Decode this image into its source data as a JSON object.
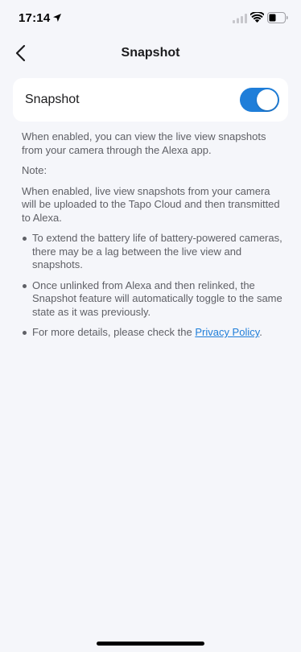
{
  "status_bar": {
    "time": "17:14",
    "location_icon": "location-arrow-icon",
    "signal_icon": "cellular-signal-icon",
    "wifi_icon": "wifi-icon",
    "battery_icon": "battery-icon"
  },
  "nav": {
    "back_icon": "chevron-left-icon",
    "title": "Snapshot"
  },
  "setting": {
    "label": "Snapshot",
    "enabled": true,
    "accent_color": "#1f7ed9"
  },
  "description": {
    "intro": "When enabled, you can view the live view snapshots from your camera through the Alexa app.",
    "note_label": "Note:",
    "note_text": "When enabled, live view snapshots from your camera will be uploaded to the Tapo Cloud and then transmitted to Alexa.",
    "bullets": [
      "To extend the battery life of battery-powered cameras, there may be a lag between the live view and snapshots.",
      "Once unlinked from Alexa and then relinked, the Snapshot feature will automatically toggle to the same state as it was previously."
    ],
    "details_prefix": "For more details, please check the ",
    "privacy_link": "Privacy Policy",
    "details_suffix": "."
  }
}
